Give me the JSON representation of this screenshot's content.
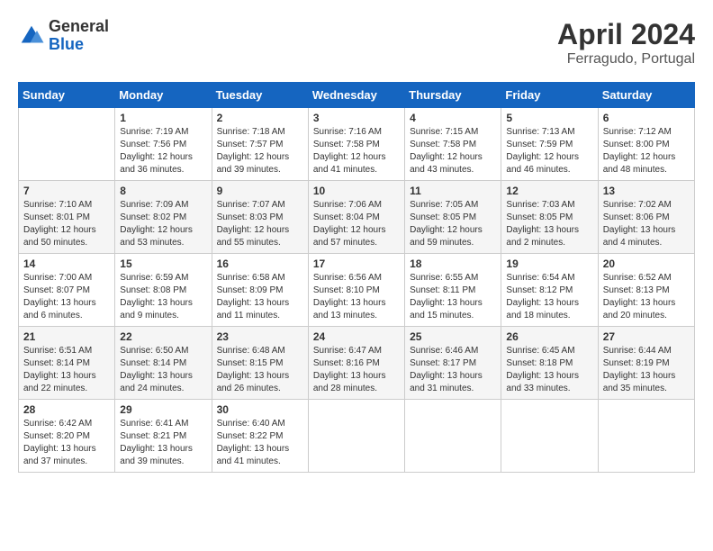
{
  "header": {
    "logo_general": "General",
    "logo_blue": "Blue",
    "month": "April 2024",
    "location": "Ferragudo, Portugal"
  },
  "weekdays": [
    "Sunday",
    "Monday",
    "Tuesday",
    "Wednesday",
    "Thursday",
    "Friday",
    "Saturday"
  ],
  "weeks": [
    [
      {
        "day": "",
        "info": ""
      },
      {
        "day": "1",
        "info": "Sunrise: 7:19 AM\nSunset: 7:56 PM\nDaylight: 12 hours\nand 36 minutes."
      },
      {
        "day": "2",
        "info": "Sunrise: 7:18 AM\nSunset: 7:57 PM\nDaylight: 12 hours\nand 39 minutes."
      },
      {
        "day": "3",
        "info": "Sunrise: 7:16 AM\nSunset: 7:58 PM\nDaylight: 12 hours\nand 41 minutes."
      },
      {
        "day": "4",
        "info": "Sunrise: 7:15 AM\nSunset: 7:58 PM\nDaylight: 12 hours\nand 43 minutes."
      },
      {
        "day": "5",
        "info": "Sunrise: 7:13 AM\nSunset: 7:59 PM\nDaylight: 12 hours\nand 46 minutes."
      },
      {
        "day": "6",
        "info": "Sunrise: 7:12 AM\nSunset: 8:00 PM\nDaylight: 12 hours\nand 48 minutes."
      }
    ],
    [
      {
        "day": "7",
        "info": "Sunrise: 7:10 AM\nSunset: 8:01 PM\nDaylight: 12 hours\nand 50 minutes."
      },
      {
        "day": "8",
        "info": "Sunrise: 7:09 AM\nSunset: 8:02 PM\nDaylight: 12 hours\nand 53 minutes."
      },
      {
        "day": "9",
        "info": "Sunrise: 7:07 AM\nSunset: 8:03 PM\nDaylight: 12 hours\nand 55 minutes."
      },
      {
        "day": "10",
        "info": "Sunrise: 7:06 AM\nSunset: 8:04 PM\nDaylight: 12 hours\nand 57 minutes."
      },
      {
        "day": "11",
        "info": "Sunrise: 7:05 AM\nSunset: 8:05 PM\nDaylight: 12 hours\nand 59 minutes."
      },
      {
        "day": "12",
        "info": "Sunrise: 7:03 AM\nSunset: 8:05 PM\nDaylight: 13 hours\nand 2 minutes."
      },
      {
        "day": "13",
        "info": "Sunrise: 7:02 AM\nSunset: 8:06 PM\nDaylight: 13 hours\nand 4 minutes."
      }
    ],
    [
      {
        "day": "14",
        "info": "Sunrise: 7:00 AM\nSunset: 8:07 PM\nDaylight: 13 hours\nand 6 minutes."
      },
      {
        "day": "15",
        "info": "Sunrise: 6:59 AM\nSunset: 8:08 PM\nDaylight: 13 hours\nand 9 minutes."
      },
      {
        "day": "16",
        "info": "Sunrise: 6:58 AM\nSunset: 8:09 PM\nDaylight: 13 hours\nand 11 minutes."
      },
      {
        "day": "17",
        "info": "Sunrise: 6:56 AM\nSunset: 8:10 PM\nDaylight: 13 hours\nand 13 minutes."
      },
      {
        "day": "18",
        "info": "Sunrise: 6:55 AM\nSunset: 8:11 PM\nDaylight: 13 hours\nand 15 minutes."
      },
      {
        "day": "19",
        "info": "Sunrise: 6:54 AM\nSunset: 8:12 PM\nDaylight: 13 hours\nand 18 minutes."
      },
      {
        "day": "20",
        "info": "Sunrise: 6:52 AM\nSunset: 8:13 PM\nDaylight: 13 hours\nand 20 minutes."
      }
    ],
    [
      {
        "day": "21",
        "info": "Sunrise: 6:51 AM\nSunset: 8:14 PM\nDaylight: 13 hours\nand 22 minutes."
      },
      {
        "day": "22",
        "info": "Sunrise: 6:50 AM\nSunset: 8:14 PM\nDaylight: 13 hours\nand 24 minutes."
      },
      {
        "day": "23",
        "info": "Sunrise: 6:48 AM\nSunset: 8:15 PM\nDaylight: 13 hours\nand 26 minutes."
      },
      {
        "day": "24",
        "info": "Sunrise: 6:47 AM\nSunset: 8:16 PM\nDaylight: 13 hours\nand 28 minutes."
      },
      {
        "day": "25",
        "info": "Sunrise: 6:46 AM\nSunset: 8:17 PM\nDaylight: 13 hours\nand 31 minutes."
      },
      {
        "day": "26",
        "info": "Sunrise: 6:45 AM\nSunset: 8:18 PM\nDaylight: 13 hours\nand 33 minutes."
      },
      {
        "day": "27",
        "info": "Sunrise: 6:44 AM\nSunset: 8:19 PM\nDaylight: 13 hours\nand 35 minutes."
      }
    ],
    [
      {
        "day": "28",
        "info": "Sunrise: 6:42 AM\nSunset: 8:20 PM\nDaylight: 13 hours\nand 37 minutes."
      },
      {
        "day": "29",
        "info": "Sunrise: 6:41 AM\nSunset: 8:21 PM\nDaylight: 13 hours\nand 39 minutes."
      },
      {
        "day": "30",
        "info": "Sunrise: 6:40 AM\nSunset: 8:22 PM\nDaylight: 13 hours\nand 41 minutes."
      },
      {
        "day": "",
        "info": ""
      },
      {
        "day": "",
        "info": ""
      },
      {
        "day": "",
        "info": ""
      },
      {
        "day": "",
        "info": ""
      }
    ]
  ]
}
